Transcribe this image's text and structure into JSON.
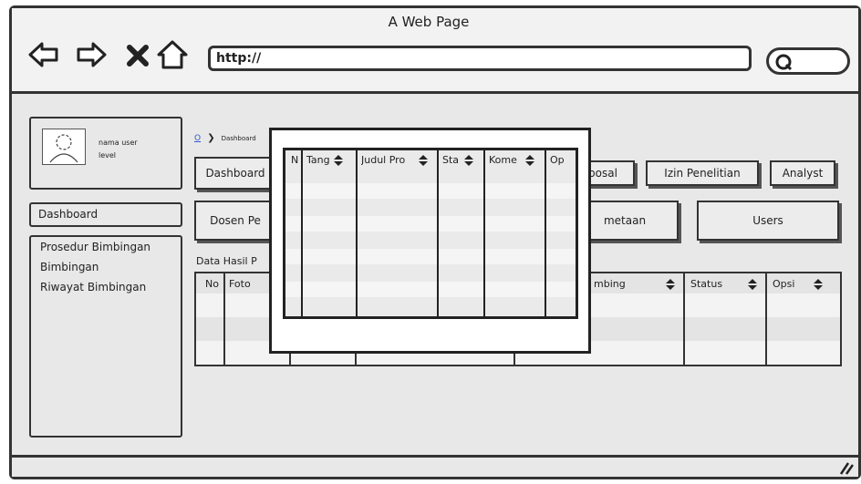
{
  "window": {
    "title": "A Web Page",
    "url": "http://"
  },
  "nav_icons": [
    "back-arrow-icon",
    "forward-arrow-icon",
    "close-x-icon",
    "home-icon"
  ],
  "profile": {
    "name": "nama user",
    "level": "level"
  },
  "sidebar": {
    "active_item": "Dashboard",
    "items": [
      "Prosedur Bimbingan",
      "Bimbingan",
      "Riwayat Bimbingan"
    ]
  },
  "breadcrumb": {
    "home": "O",
    "current": "Dashboard"
  },
  "tabs_row1": [
    "Dashboard",
    "posal",
    "Izin Penelitian",
    "Analyst"
  ],
  "tabs_row2": [
    "Dosen Pe",
    "metaan",
    "Users"
  ],
  "section_label": "Data Hasil P",
  "table": {
    "headers": [
      "No",
      "Foto",
      "mbing",
      "Status",
      "Opsi"
    ]
  },
  "modal_table": {
    "headers": [
      "N",
      "Tang",
      "Judul Pro",
      "Sta",
      "Kome",
      "Op"
    ]
  }
}
